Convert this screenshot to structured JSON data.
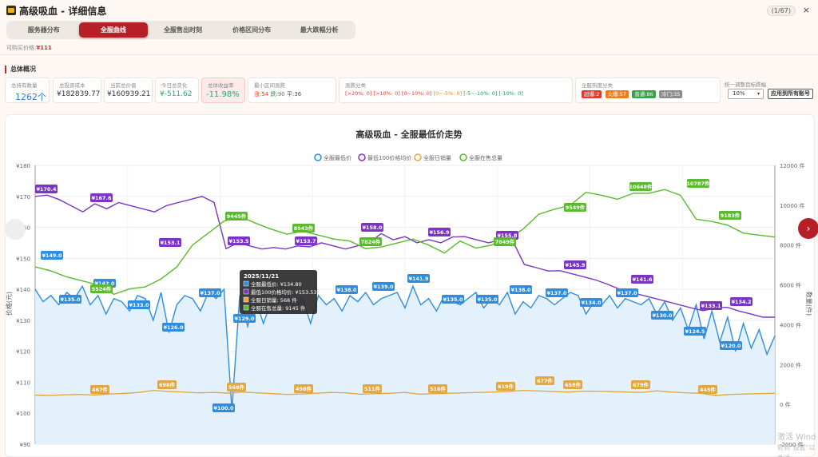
{
  "window": {
    "title": "高级吸血 - 详细信息",
    "counter": "(1/67)",
    "close": "×"
  },
  "tabs": [
    {
      "label": "服务器分布",
      "active": false
    },
    {
      "label": "全服曲线",
      "active": true
    },
    {
      "label": "全服售出时刻",
      "active": false
    },
    {
      "label": "价格区间分布",
      "active": false
    },
    {
      "label": "最大跌幅分析",
      "active": false
    }
  ],
  "budget": {
    "label": "可购买价格:",
    "value": "¥111"
  },
  "overview": {
    "title": "总体概况",
    "cards": [
      {
        "label": "总持有数量",
        "value": "1262个"
      },
      {
        "label": "总投资成本",
        "value": "¥182839.77"
      },
      {
        "label": "当前总价值",
        "value": "¥160939.21"
      },
      {
        "label": "今日总变化",
        "value": "¥-511.62"
      },
      {
        "label": "总体收益率",
        "value": "-11.98%"
      }
    ],
    "minchange": {
      "label": "最小区间涨跌",
      "up": "涨:54",
      "flat": "跌:90",
      "down": "平:36"
    },
    "range": {
      "label": "涨跌分类",
      "items": [
        "[>20%: 0]",
        "[>10%: 0]",
        "[0~10%: 0]",
        "[0~-5%: 0]",
        "[-5~-10%: 0]",
        "[-10%: 0]"
      ]
    },
    "heat": {
      "label": "全服热度分类",
      "badges": [
        "超爆:2",
        "火爆:57",
        "普通:86",
        "冷门:35"
      ]
    },
    "target": {
      "label": "统一调整目标跌幅",
      "select": "10%",
      "arrow": "▾",
      "button": "应用到所有账号"
    }
  },
  "colors": {
    "primary": "#b61f26",
    "min_price": "#2e8de0",
    "avg100": "#7b35c4",
    "daily_sales": "#e4a640",
    "listing": "#5ab92c"
  },
  "chart_data": {
    "type": "line",
    "title": "高级吸血 - 全服最低价走势",
    "legend": [
      "全服最低价",
      "最低100价格均价",
      "全服日销量",
      "全服在售总量"
    ],
    "legend_placement": "top-center",
    "ylabel_left": "价格(元)",
    "ylabel_right": "数量(件)",
    "y_left": {
      "min": 90,
      "max": 180,
      "ticks": [
        "¥90",
        "¥100",
        "¥110",
        "¥120",
        "¥130",
        "¥140",
        "¥150",
        "¥160",
        "¥170",
        "¥180"
      ]
    },
    "y_right": {
      "min": -2000,
      "max": 12000,
      "ticks": [
        "-2000 件",
        "0 件",
        "2000 件",
        "4000 件",
        "6000 件",
        "8000 件",
        "10000 件",
        "12000 件"
      ]
    },
    "grid": true,
    "series": [
      {
        "name": "全服最低价",
        "values": [
          140,
          136,
          138,
          135,
          139,
          137,
          141,
          135,
          138,
          132,
          137,
          136,
          133,
          138,
          137,
          130,
          139,
          126,
          135,
          138,
          137,
          133,
          139,
          137,
          140,
          101,
          138,
          128,
          137,
          129,
          136,
          133,
          139,
          134,
          137,
          129,
          138,
          135,
          137,
          133,
          138,
          136,
          139,
          135,
          137,
          138,
          139,
          134,
          141,
          135,
          137,
          133,
          138,
          136,
          135,
          137,
          139,
          134,
          137,
          135,
          139,
          132,
          136,
          134,
          138,
          137,
          135,
          137,
          139,
          138,
          132,
          136,
          135,
          138,
          134,
          137,
          136,
          135,
          137,
          132,
          136,
          130,
          134,
          127,
          135,
          124,
          133,
          123,
          131,
          120,
          129,
          121,
          127,
          119,
          125
        ]
      },
      {
        "name": "最低100价格均价",
        "values": [
          170,
          170.4,
          169,
          167,
          165,
          167.6,
          166,
          168,
          167,
          166,
          165,
          167,
          168,
          169,
          170,
          168,
          153.1,
          155,
          154,
          153,
          153.5,
          153,
          154,
          153.7,
          155,
          154,
          153,
          154,
          155,
          158,
          156,
          157,
          155,
          156,
          155,
          156.9,
          157,
          156,
          155,
          156,
          155.8,
          148,
          147,
          145.9,
          146,
          145,
          144,
          143,
          141.6,
          140,
          139,
          138,
          137,
          136,
          135,
          134,
          133.1,
          134,
          134.2,
          133,
          132,
          131,
          131
        ]
      },
      {
        "name": "全服日销量",
        "values": [
          467,
          450,
          480,
          500,
          470,
          520,
          550,
          600,
          698,
          650,
          620,
          580,
          600,
          568,
          620,
          580,
          540,
          498,
          520,
          560,
          600,
          580,
          511,
          540,
          560,
          600,
          510,
          540,
          560,
          580,
          600,
          619,
          650,
          700,
          677,
          650,
          620,
          660,
          658,
          640,
          620,
          600,
          679,
          620,
          580,
          560,
          445,
          500,
          520,
          540,
          560
        ]
      },
      {
        "name": "全服在售总量",
        "values": [
          6900,
          6700,
          6400,
          6200,
          6000,
          5524,
          5800,
          5900,
          6300,
          6900,
          8000,
          8600,
          9200,
          9445,
          9100,
          8800,
          8543,
          8700,
          8500,
          8300,
          8200,
          7824,
          7900,
          8100,
          8300,
          8000,
          7600,
          8200,
          7849,
          8000,
          8300,
          8800,
          9549,
          9800,
          10000,
          10648,
          10500,
          10300,
          10600,
          10600,
          10787,
          10500,
          9300,
          9183,
          9000,
          8600,
          8500,
          8400
        ]
      }
    ],
    "labels": {
      "min_price": [
        "¥149.0",
        "¥142.0",
        "¥135.0",
        "¥133.0",
        "¥126.0",
        "¥137.0",
        "¥100.0",
        "¥129.0",
        "¥138.0",
        "¥139.0",
        "¥141.9",
        "¥135.0",
        "¥135.0",
        "¥138.0",
        "¥137.0",
        "¥134.0",
        "¥137.0",
        "¥130.0",
        "¥124.5",
        "¥120.0"
      ],
      "avg100": [
        "¥170.4",
        "¥167.6",
        "¥153.1",
        "¥153.5",
        "¥153.7",
        "¥158.0",
        "¥156.9",
        "¥155.8",
        "¥145.9",
        "¥141.6",
        "¥133.1",
        "¥134.2"
      ],
      "daily": [
        "467件",
        "698件",
        "568件",
        "498件",
        "511件",
        "516件",
        "619件",
        "677件",
        "658件",
        "679件",
        "445件"
      ],
      "listing": [
        "5524件",
        "9445件",
        "8543件",
        "7824件",
        "7849件",
        "9549件",
        "10648件",
        "10787件",
        "9183件"
      ]
    },
    "tooltip": {
      "date": "2025/11/21",
      "rows": [
        "全服最低价: ¥134.80",
        "最低100价格均价: ¥153.53",
        "全服日销量: 568 件",
        "全服在售总量: 9145 件"
      ]
    }
  },
  "watermark": {
    "line1": "激活 Wind",
    "line2": "转到\"设置\"以激活 Windows"
  }
}
